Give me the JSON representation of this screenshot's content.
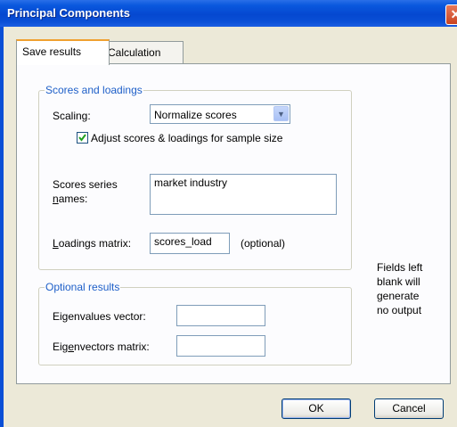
{
  "window": {
    "title": "Principal Components",
    "close_glyph": "✕"
  },
  "tabs": [
    {
      "label": "Save results",
      "active": true
    },
    {
      "label": "Calculation",
      "active": false
    }
  ],
  "scores_group": {
    "label": "Scores and loadings",
    "scaling_label": "Scaling:",
    "scaling_value": "Normalize scores",
    "adjust_checkbox": {
      "label_pre": "Ad",
      "label_u": "j",
      "label_post": "ust scores & loadings for sample size",
      "checked": true
    },
    "series_label_line1": "Scores series",
    "series_label_line2_u": "n",
    "series_label_line2": "ames:",
    "series_value": "market industry",
    "loadings_label_u": "L",
    "loadings_label": "oadings matrix:",
    "loadings_value": "scores_load",
    "optional_note": "(optional)"
  },
  "optional_group": {
    "label": "Optional results",
    "eigenvalues_label_pre": "Ei",
    "eigenvalues_label_u": "g",
    "eigenvalues_label_post": "envalues vector:",
    "eigenvalues_value": "",
    "eigenvectors_label_pre": "Eig",
    "eigenvectors_label_u": "e",
    "eigenvectors_label_post": "nvectors matrix:",
    "eigenvectors_value": ""
  },
  "hint": {
    "line1": "Fields left",
    "line2": "blank will",
    "line3": "generate",
    "line4": "no output"
  },
  "buttons": {
    "ok": "OK",
    "cancel": "Cancel"
  },
  "colors": {
    "title_bar": "#0548d0",
    "group_label": "#1e5fc8",
    "dialog_bg": "#ece9d8"
  }
}
